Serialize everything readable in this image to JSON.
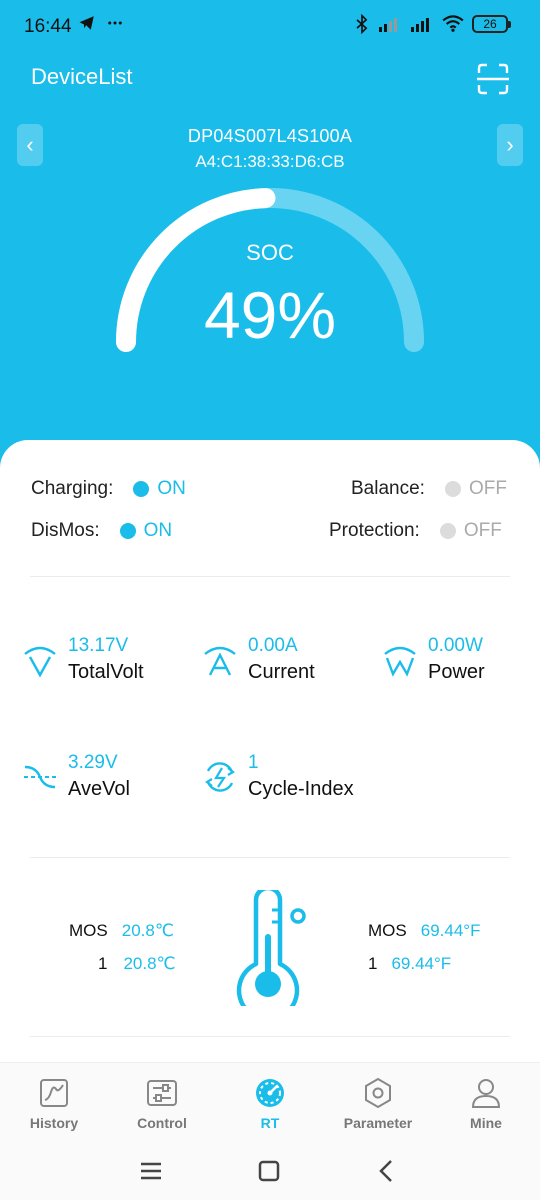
{
  "status_bar": {
    "time": "16:44",
    "battery": "26",
    "icons": [
      "telegram-icon",
      "more-dots-icon",
      "bluetooth-icon",
      "signal-icon",
      "signal-icon",
      "wifi-icon",
      "battery-icon"
    ]
  },
  "header": {
    "title": "DeviceList",
    "scan_icon": "scan-icon"
  },
  "device": {
    "name": "DP04S007L4S100A",
    "mac": "A4:C1:38:33:D6:CB",
    "prev_label": "‹",
    "next_label": "›"
  },
  "soc": {
    "label": "SOC",
    "value": "49%",
    "fraction": 0.49
  },
  "states": {
    "charging": {
      "label": "Charging:",
      "value": "ON"
    },
    "balance": {
      "label": "Balance:",
      "value": "OFF"
    },
    "dismos": {
      "label": "DisMos:",
      "value": "ON"
    },
    "protection": {
      "label": "Protection:",
      "value": "OFF"
    }
  },
  "metrics": {
    "total_volt": {
      "value": "13.17V",
      "label": "TotalVolt",
      "icon": "volt-icon"
    },
    "current": {
      "value": "0.00A",
      "label": "Current",
      "icon": "ampere-icon"
    },
    "power": {
      "value": "0.00W",
      "label": "Power",
      "icon": "watt-icon"
    },
    "ave_vol": {
      "value": "3.29V",
      "label": "AveVol",
      "icon": "average-volt-icon"
    },
    "cycle_index": {
      "value": "1",
      "label": "Cycle-Index",
      "icon": "cycle-icon"
    }
  },
  "temperature": {
    "celsius": [
      {
        "name": "MOS",
        "value": "20.8℃"
      },
      {
        "name": "1",
        "value": "20.8℃"
      }
    ],
    "fahrenheit": [
      {
        "name": "MOS",
        "value": "69.44°F"
      },
      {
        "name": "1",
        "value": "69.44°F"
      }
    ]
  },
  "bottom_nav": [
    {
      "label": "History",
      "icon": "history-chart-icon",
      "active": false
    },
    {
      "label": "Control",
      "icon": "control-sliders-icon",
      "active": false
    },
    {
      "label": "RT",
      "icon": "gauge-icon",
      "active": true
    },
    {
      "label": "Parameter",
      "icon": "hexagon-settings-icon",
      "active": false
    },
    {
      "label": "Mine",
      "icon": "user-icon",
      "active": false
    }
  ],
  "colors": {
    "accent": "#1ABDEA",
    "off": "#dcdcdc"
  }
}
